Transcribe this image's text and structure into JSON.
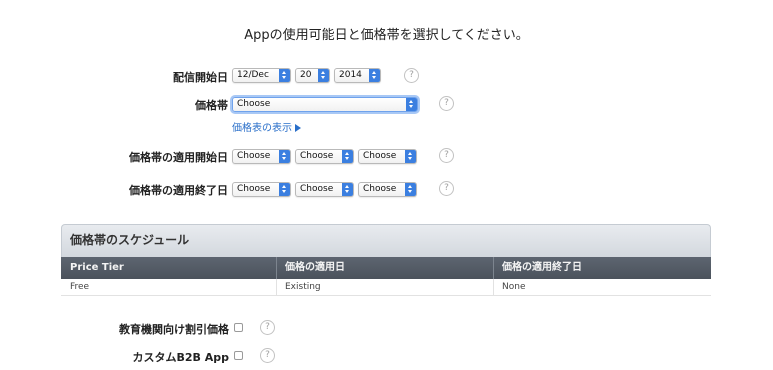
{
  "title": "Appの使用可能日と価格帯を選択してください。",
  "availability": {
    "label": "配信開始日",
    "day_month": "12/Dec",
    "day": "20",
    "year": "2014"
  },
  "price_tier": {
    "label": "価格帯",
    "value": "Choose",
    "link": "価格表の表示"
  },
  "tier_start": {
    "label": "価格帯の適用開始日",
    "month": "Choose",
    "day": "Choose",
    "year": "Choose"
  },
  "tier_end": {
    "label": "価格帯の適用終了日",
    "month": "Choose",
    "day": "Choose",
    "year": "Choose"
  },
  "schedule": {
    "heading": "価格帯のスケジュール",
    "columns": [
      "Price Tier",
      "価格の適用日",
      "価格の適用終了日"
    ],
    "rows": [
      [
        "Free",
        "Existing",
        "None"
      ]
    ]
  },
  "edu_discount": {
    "label": "教育機関向け割引価格"
  },
  "custom_b2b": {
    "label": "カスタムB2B App"
  },
  "help_glyph": "?",
  "icons": {
    "help": "question-circle-icon",
    "select_arrow": "updown-arrows-icon",
    "link_arrow": "triangle-right-icon"
  },
  "colors": {
    "accent": "#3b7fe0",
    "link": "#2a6fc9",
    "table_header": "#535a64"
  }
}
